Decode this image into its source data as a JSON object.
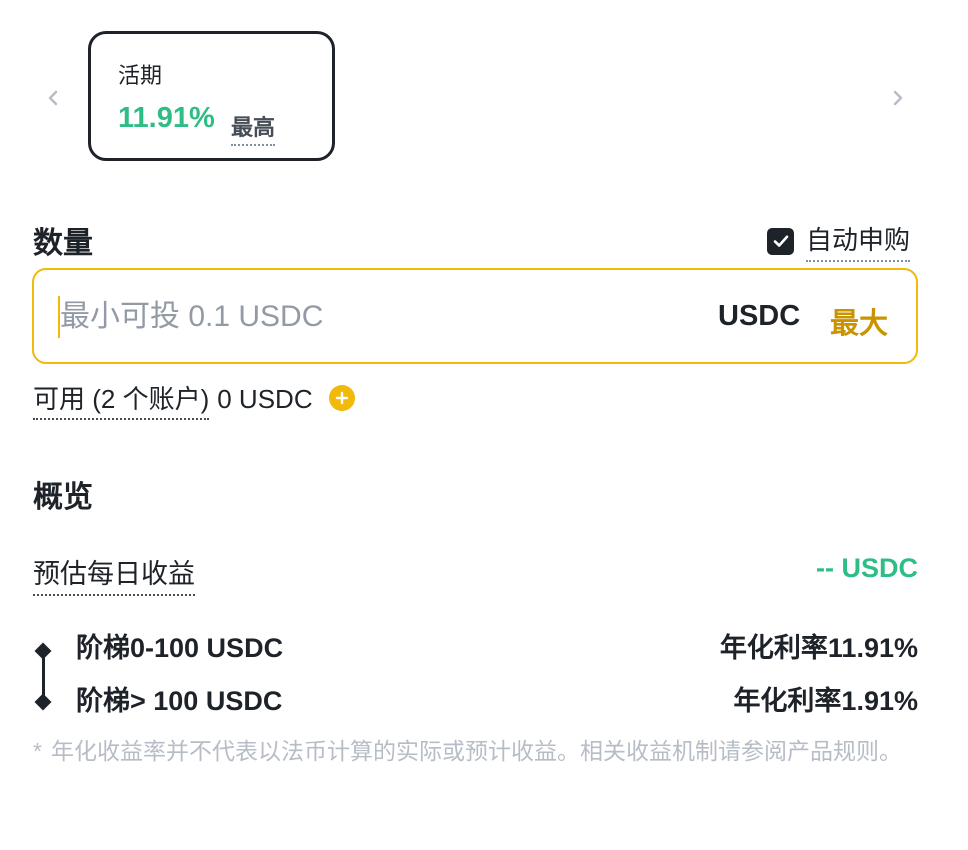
{
  "carousel": {
    "prev_icon": "chevron-left-icon",
    "next_icon": "chevron-right-icon",
    "product": {
      "term": "活期",
      "apr": "11.91%",
      "max_tag": "最高"
    }
  },
  "amount": {
    "title": "数量",
    "auto_subscribe_label": "自动申购",
    "auto_subscribe_checked": true,
    "input_value": "",
    "input_placeholder": "最小可投 0.1 USDC",
    "unit": "USDC",
    "max_label": "最大",
    "available_label": "可用 (2 个账户)",
    "available_value": "0 USDC",
    "add_icon": "plus-circle-icon"
  },
  "overview": {
    "title": "概览",
    "daily_earnings_label": "预估每日收益",
    "daily_earnings_value": "-- USDC",
    "tiers": [
      {
        "range": "阶梯0-100 USDC",
        "rate": "年化利率11.91%"
      },
      {
        "range": "阶梯> 100 USDC",
        "rate": "年化利率1.91%"
      }
    ],
    "disclaimer_star": "*",
    "disclaimer": "年化收益率并不代表以法币计算的实际或预计收益。相关收益机制请参阅产品规则。"
  },
  "colors": {
    "accent_yellow": "#f0b90b",
    "max_gold": "#c99400",
    "green": "#2ebd85",
    "text": "#1e2329",
    "muted": "#b7bdc6"
  }
}
